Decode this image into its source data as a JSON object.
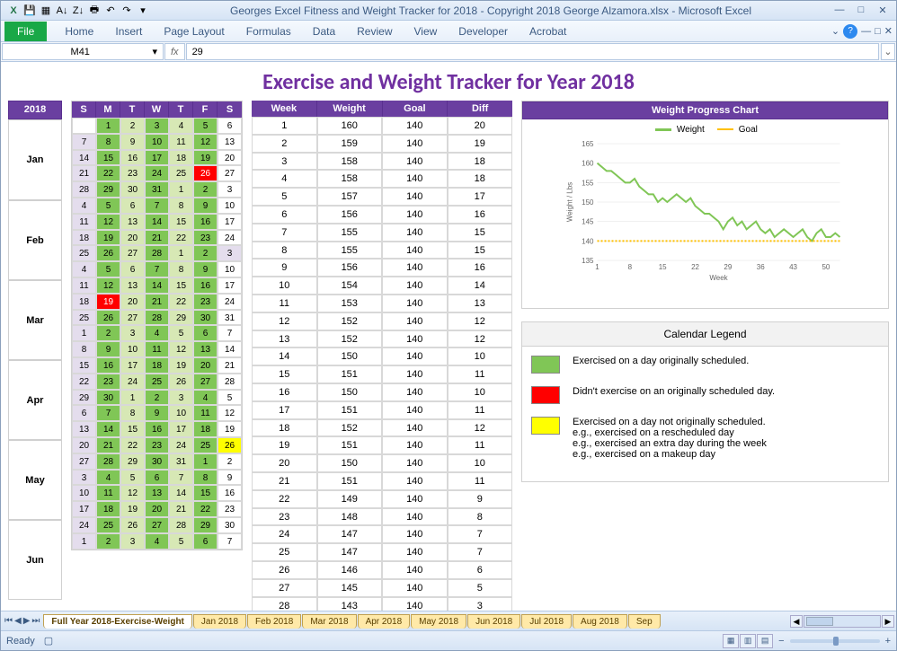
{
  "window": {
    "title": "Georges Excel Fitness and Weight Tracker for 2018 - Copyright 2018 George Alzamora.xlsx  -  Microsoft Excel",
    "controls": [
      "—",
      "□",
      "✕"
    ]
  },
  "ribbon": {
    "file": "File",
    "tabs": [
      "Home",
      "Insert",
      "Page Layout",
      "Formulas",
      "Data",
      "Review",
      "View",
      "Developer",
      "Acrobat"
    ],
    "help": "?"
  },
  "formula_bar": {
    "namebox": "M41",
    "fx": "fx",
    "value": "29"
  },
  "sheet": {
    "title": "Exercise and Weight Tracker for Year 2018",
    "year": "2018",
    "months": [
      "Jan",
      "Feb",
      "Mar",
      "Apr",
      "May",
      "Jun"
    ],
    "day_headers": [
      "S",
      "M",
      "T",
      "W",
      "T",
      "F",
      "S"
    ],
    "calendar_rows": [
      [
        [
          "",
          "w"
        ],
        [
          "1",
          "g"
        ],
        [
          "2",
          "lg"
        ],
        [
          "3",
          "g"
        ],
        [
          "4",
          "lg"
        ],
        [
          "5",
          "g"
        ],
        [
          "6",
          "w"
        ]
      ],
      [
        [
          "7",
          "lv"
        ],
        [
          "8",
          "g"
        ],
        [
          "9",
          "lg"
        ],
        [
          "10",
          "g"
        ],
        [
          "11",
          "lg"
        ],
        [
          "12",
          "g"
        ],
        [
          "13",
          "w"
        ]
      ],
      [
        [
          "14",
          "lv"
        ],
        [
          "15",
          "g"
        ],
        [
          "16",
          "lg"
        ],
        [
          "17",
          "g"
        ],
        [
          "18",
          "lg"
        ],
        [
          "19",
          "g"
        ],
        [
          "20",
          "w"
        ]
      ],
      [
        [
          "21",
          "lv"
        ],
        [
          "22",
          "g"
        ],
        [
          "23",
          "lg"
        ],
        [
          "24",
          "g"
        ],
        [
          "25",
          "lg"
        ],
        [
          "26",
          "r"
        ],
        [
          "27",
          "w"
        ]
      ],
      [
        [
          "28",
          "lv"
        ],
        [
          "29",
          "g"
        ],
        [
          "30",
          "lg"
        ],
        [
          "31",
          "g"
        ],
        [
          "1",
          "lg"
        ],
        [
          "2",
          "g"
        ],
        [
          "3",
          "w"
        ]
      ],
      [
        [
          "4",
          "lv"
        ],
        [
          "5",
          "g"
        ],
        [
          "6",
          "lg"
        ],
        [
          "7",
          "g"
        ],
        [
          "8",
          "lg"
        ],
        [
          "9",
          "g"
        ],
        [
          "10",
          "w"
        ]
      ],
      [
        [
          "11",
          "lv"
        ],
        [
          "12",
          "g"
        ],
        [
          "13",
          "lg"
        ],
        [
          "14",
          "g"
        ],
        [
          "15",
          "lg"
        ],
        [
          "16",
          "g"
        ],
        [
          "17",
          "w"
        ]
      ],
      [
        [
          "18",
          "lv"
        ],
        [
          "19",
          "g"
        ],
        [
          "20",
          "lg"
        ],
        [
          "21",
          "g"
        ],
        [
          "22",
          "lg"
        ],
        [
          "23",
          "g"
        ],
        [
          "24",
          "w"
        ]
      ],
      [
        [
          "25",
          "lv"
        ],
        [
          "26",
          "g"
        ],
        [
          "27",
          "lg"
        ],
        [
          "28",
          "g"
        ],
        [
          "1",
          "lg"
        ],
        [
          "2",
          "g"
        ],
        [
          "3",
          "lv"
        ]
      ],
      [
        [
          "4",
          "lv"
        ],
        [
          "5",
          "g"
        ],
        [
          "6",
          "lg"
        ],
        [
          "7",
          "g"
        ],
        [
          "8",
          "lg"
        ],
        [
          "9",
          "g"
        ],
        [
          "10",
          "w"
        ]
      ],
      [
        [
          "11",
          "lv"
        ],
        [
          "12",
          "g"
        ],
        [
          "13",
          "lg"
        ],
        [
          "14",
          "g"
        ],
        [
          "15",
          "lg"
        ],
        [
          "16",
          "g"
        ],
        [
          "17",
          "w"
        ]
      ],
      [
        [
          "18",
          "lv"
        ],
        [
          "19",
          "r"
        ],
        [
          "20",
          "lg"
        ],
        [
          "21",
          "g"
        ],
        [
          "22",
          "lg"
        ],
        [
          "23",
          "g"
        ],
        [
          "24",
          "w"
        ]
      ],
      [
        [
          "25",
          "lv"
        ],
        [
          "26",
          "g"
        ],
        [
          "27",
          "lg"
        ],
        [
          "28",
          "g"
        ],
        [
          "29",
          "lg"
        ],
        [
          "30",
          "g"
        ],
        [
          "31",
          "w"
        ]
      ],
      [
        [
          "1",
          "lv"
        ],
        [
          "2",
          "g"
        ],
        [
          "3",
          "lg"
        ],
        [
          "4",
          "g"
        ],
        [
          "5",
          "lg"
        ],
        [
          "6",
          "g"
        ],
        [
          "7",
          "w"
        ]
      ],
      [
        [
          "8",
          "lv"
        ],
        [
          "9",
          "g"
        ],
        [
          "10",
          "lg"
        ],
        [
          "11",
          "g"
        ],
        [
          "12",
          "lg"
        ],
        [
          "13",
          "g"
        ],
        [
          "14",
          "w"
        ]
      ],
      [
        [
          "15",
          "lv"
        ],
        [
          "16",
          "g"
        ],
        [
          "17",
          "lg"
        ],
        [
          "18",
          "g"
        ],
        [
          "19",
          "lg"
        ],
        [
          "20",
          "g"
        ],
        [
          "21",
          "w"
        ]
      ],
      [
        [
          "22",
          "lv"
        ],
        [
          "23",
          "g"
        ],
        [
          "24",
          "lg"
        ],
        [
          "25",
          "g"
        ],
        [
          "26",
          "lg"
        ],
        [
          "27",
          "g"
        ],
        [
          "28",
          "w"
        ]
      ],
      [
        [
          "29",
          "lv"
        ],
        [
          "30",
          "g"
        ],
        [
          "1",
          "lg"
        ],
        [
          "2",
          "g"
        ],
        [
          "3",
          "lg"
        ],
        [
          "4",
          "g"
        ],
        [
          "5",
          "w"
        ]
      ],
      [
        [
          "6",
          "lv"
        ],
        [
          "7",
          "g"
        ],
        [
          "8",
          "lg"
        ],
        [
          "9",
          "g"
        ],
        [
          "10",
          "lg"
        ],
        [
          "11",
          "g"
        ],
        [
          "12",
          "w"
        ]
      ],
      [
        [
          "13",
          "lv"
        ],
        [
          "14",
          "g"
        ],
        [
          "15",
          "lg"
        ],
        [
          "16",
          "g"
        ],
        [
          "17",
          "lg"
        ],
        [
          "18",
          "g"
        ],
        [
          "19",
          "w"
        ]
      ],
      [
        [
          "20",
          "lv"
        ],
        [
          "21",
          "g"
        ],
        [
          "22",
          "lg"
        ],
        [
          "23",
          "g"
        ],
        [
          "24",
          "lg"
        ],
        [
          "25",
          "g"
        ],
        [
          "26",
          "y"
        ]
      ],
      [
        [
          "27",
          "lv"
        ],
        [
          "28",
          "g"
        ],
        [
          "29",
          "lg"
        ],
        [
          "30",
          "g"
        ],
        [
          "31",
          "lg"
        ],
        [
          "1",
          "g"
        ],
        [
          "2",
          "w"
        ]
      ],
      [
        [
          "3",
          "lv"
        ],
        [
          "4",
          "g"
        ],
        [
          "5",
          "lg"
        ],
        [
          "6",
          "g"
        ],
        [
          "7",
          "lg"
        ],
        [
          "8",
          "g"
        ],
        [
          "9",
          "w"
        ]
      ],
      [
        [
          "10",
          "lv"
        ],
        [
          "11",
          "g"
        ],
        [
          "12",
          "lg"
        ],
        [
          "13",
          "g"
        ],
        [
          "14",
          "lg"
        ],
        [
          "15",
          "g"
        ],
        [
          "16",
          "w"
        ]
      ],
      [
        [
          "17",
          "lv"
        ],
        [
          "18",
          "g"
        ],
        [
          "19",
          "lg"
        ],
        [
          "20",
          "g"
        ],
        [
          "21",
          "lg"
        ],
        [
          "22",
          "g"
        ],
        [
          "23",
          "w"
        ]
      ],
      [
        [
          "24",
          "lv"
        ],
        [
          "25",
          "g"
        ],
        [
          "26",
          "lg"
        ],
        [
          "27",
          "g"
        ],
        [
          "28",
          "lg"
        ],
        [
          "29",
          "g"
        ],
        [
          "30",
          "w"
        ]
      ],
      [
        [
          "1",
          "lv"
        ],
        [
          "2",
          "g"
        ],
        [
          "3",
          "lg"
        ],
        [
          "4",
          "g"
        ],
        [
          "5",
          "lg"
        ],
        [
          "6",
          "g"
        ],
        [
          "7",
          "w"
        ]
      ]
    ],
    "weight_headers": [
      "Week",
      "Weight",
      "Goal",
      "Diff"
    ],
    "rows": [
      [
        "1",
        160,
        140,
        20
      ],
      [
        "2",
        159,
        140,
        19
      ],
      [
        "3",
        158,
        140,
        18
      ],
      [
        "4",
        158,
        140,
        18
      ],
      [
        "5",
        157,
        140,
        17
      ],
      [
        "6",
        156,
        140,
        16
      ],
      [
        "7",
        155,
        140,
        15
      ],
      [
        "8",
        155,
        140,
        15
      ],
      [
        "9",
        156,
        140,
        16
      ],
      [
        "10",
        154,
        140,
        14
      ],
      [
        "11",
        153,
        140,
        13
      ],
      [
        "12",
        152,
        140,
        12
      ],
      [
        "13",
        152,
        140,
        12
      ],
      [
        "14",
        150,
        140,
        10
      ],
      [
        "15",
        151,
        140,
        11
      ],
      [
        "16",
        150,
        140,
        10
      ],
      [
        "17",
        151,
        140,
        11
      ],
      [
        "18",
        152,
        140,
        12
      ],
      [
        "19",
        151,
        140,
        11
      ],
      [
        "20",
        150,
        140,
        10
      ],
      [
        "21",
        151,
        140,
        11
      ],
      [
        "22",
        149,
        140,
        9
      ],
      [
        "23",
        148,
        140,
        8
      ],
      [
        "24",
        147,
        140,
        7
      ],
      [
        "25",
        147,
        140,
        7
      ],
      [
        "26",
        146,
        140,
        6
      ],
      [
        "27",
        145,
        140,
        5
      ],
      [
        "28",
        143,
        140,
        3
      ]
    ],
    "chart": {
      "title": "Weight Progress Chart",
      "series": [
        {
          "name": "Weight",
          "color": "#80c656"
        },
        {
          "name": "Goal",
          "color": "#ffc000"
        }
      ],
      "ylabel": "Weight / Lbs",
      "xlabel": "Week",
      "yticks": [
        135,
        140,
        145,
        150,
        155,
        160,
        165
      ],
      "xticks": [
        1,
        8,
        15,
        22,
        29,
        36,
        43,
        50
      ]
    },
    "legend": {
      "title": "Calendar Legend",
      "items": [
        {
          "color": "#80c656",
          "text": "Exercised on a day originally scheduled."
        },
        {
          "color": "#ff0000",
          "text": "Didn't exercise on an originally scheduled day."
        },
        {
          "color": "#ffff00",
          "text": "Exercised on a day not originally scheduled.\ne.g., exercised on a rescheduled day\ne.g., exercised an extra day during the week\ne.g., exercised on a makeup day"
        }
      ]
    }
  },
  "footer": {
    "tabs": [
      "Full Year 2018-Exercise-Weight",
      "Jan 2018",
      "Feb 2018",
      "Mar 2018",
      "Apr 2018",
      "May 2018",
      "Jun 2018",
      "Jul 2018",
      "Aug 2018",
      "Sep"
    ],
    "status": "Ready",
    "zoom_minus": "−",
    "zoom_plus": "+"
  },
  "chart_data": {
    "type": "line",
    "title": "Weight Progress Chart",
    "xlabel": "Week",
    "ylabel": "Weight / Lbs",
    "xlim": [
      1,
      53
    ],
    "ylim": [
      135,
      165
    ],
    "xticks": [
      1,
      8,
      15,
      22,
      29,
      36,
      43,
      50
    ],
    "yticks": [
      135,
      140,
      145,
      150,
      155,
      160,
      165
    ],
    "x": [
      1,
      2,
      3,
      4,
      5,
      6,
      7,
      8,
      9,
      10,
      11,
      12,
      13,
      14,
      15,
      16,
      17,
      18,
      19,
      20,
      21,
      22,
      23,
      24,
      25,
      26,
      27,
      28,
      29,
      30,
      31,
      32,
      33,
      34,
      35,
      36,
      37,
      38,
      39,
      40,
      41,
      42,
      43,
      44,
      45,
      46,
      47,
      48,
      49,
      50,
      51,
      52,
      53
    ],
    "series": [
      {
        "name": "Weight",
        "color": "#80c656",
        "values": [
          160,
          159,
          158,
          158,
          157,
          156,
          155,
          155,
          156,
          154,
          153,
          152,
          152,
          150,
          151,
          150,
          151,
          152,
          151,
          150,
          151,
          149,
          148,
          147,
          147,
          146,
          145,
          143,
          145,
          146,
          144,
          145,
          143,
          144,
          145,
          143,
          142,
          143,
          141,
          142,
          143,
          142,
          141,
          142,
          143,
          141,
          140,
          142,
          143,
          141,
          141,
          142,
          141
        ]
      },
      {
        "name": "Goal",
        "color": "#ffc000",
        "values": [
          140,
          140,
          140,
          140,
          140,
          140,
          140,
          140,
          140,
          140,
          140,
          140,
          140,
          140,
          140,
          140,
          140,
          140,
          140,
          140,
          140,
          140,
          140,
          140,
          140,
          140,
          140,
          140,
          140,
          140,
          140,
          140,
          140,
          140,
          140,
          140,
          140,
          140,
          140,
          140,
          140,
          140,
          140,
          140,
          140,
          140,
          140,
          140,
          140,
          140,
          140,
          140,
          140
        ]
      }
    ]
  }
}
